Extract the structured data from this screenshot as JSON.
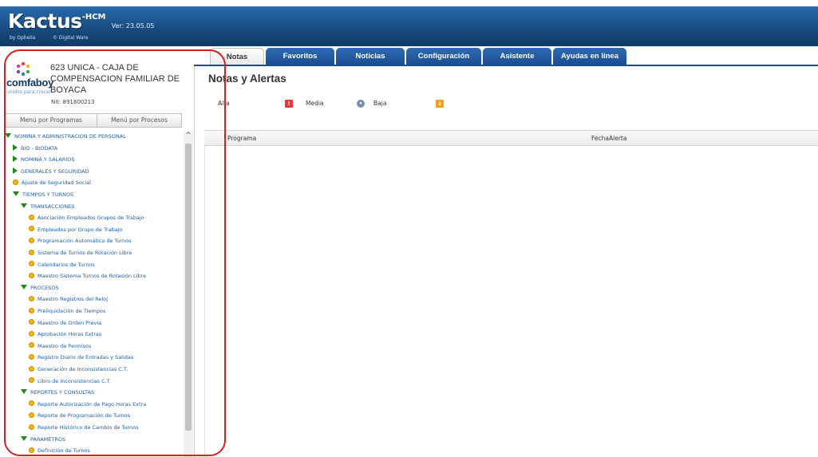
{
  "app": {
    "brand": "Kactus",
    "brand_suffix": "-HCM",
    "version": "Ver: 23.05.05",
    "by_line": "by Ophelia",
    "by_line2": "© Digital Ware"
  },
  "org": {
    "logo_word": "comfaboy",
    "logo_tagline": "unidos para crecer",
    "name": "623 UNICA - CAJA DE COMPENSACION FAMILIAR DE BOYACA",
    "nit": "Nit: 891800213"
  },
  "menu_buttons": {
    "programs": "Menú por Programas",
    "processes": "Menú por Procesos"
  },
  "tree": [
    {
      "label": "NOMINA Y ADMINISTRACION DE PERSONAL",
      "type": "open"
    },
    {
      "label": "BIO - BIODATA",
      "type": "closed"
    },
    {
      "label": "NOMINA Y SALARIOS",
      "type": "closed"
    },
    {
      "label": "GENERALES Y SEGURIDAD",
      "type": "closed"
    },
    {
      "label": "Ajuste de Seguridad Social",
      "type": "leaf"
    },
    {
      "label": "TIEMPOS Y TURNOS",
      "type": "open"
    },
    {
      "label": "TRANSACCIONES",
      "type": "open"
    },
    {
      "label": "Asociación Empleados Grupos de Trabajo",
      "type": "leaf"
    },
    {
      "label": "Empleados por Grupo de Trabajo",
      "type": "leaf"
    },
    {
      "label": "Programación Automática de Turnos",
      "type": "leaf"
    },
    {
      "label": "Sistema de Turnos de Rotación Libre",
      "type": "leaf"
    },
    {
      "label": "Calendarios de Turnos",
      "type": "leaf"
    },
    {
      "label": "Maestro Sistema Turnos de Rotación Libre",
      "type": "leaf"
    },
    {
      "label": "PROCESOS",
      "type": "open"
    },
    {
      "label": "Maestro Registros del Reloj",
      "type": "leaf"
    },
    {
      "label": "Preliquidación de Tiempos",
      "type": "leaf"
    },
    {
      "label": "Maestro de Orden Previa",
      "type": "leaf"
    },
    {
      "label": "Aprobación Horas Extras",
      "type": "leaf"
    },
    {
      "label": "Maestro de Permisos",
      "type": "leaf"
    },
    {
      "label": "Registro Diario de Entradas y Salidas",
      "type": "leaf"
    },
    {
      "label": "Generación de Inconsistencias C.T.",
      "type": "leaf"
    },
    {
      "label": "Libro de Inconsistencias C.T.",
      "type": "leaf"
    },
    {
      "label": "REPORTES Y CONSULTAS",
      "type": "open"
    },
    {
      "label": "Reporte Autorización de Pago Horas Extra",
      "type": "leaf"
    },
    {
      "label": "Reporte de Programación de Turnos",
      "type": "leaf"
    },
    {
      "label": "Reporte Histórico de Cambio de Turnos",
      "type": "leaf"
    },
    {
      "label": "PARAMETROS",
      "type": "open"
    },
    {
      "label": "Definición de Turnos",
      "type": "leaf"
    }
  ],
  "tabs": [
    {
      "label": "Notas",
      "active": true
    },
    {
      "label": "Favoritos",
      "active": false
    },
    {
      "label": "Noticias",
      "active": false
    },
    {
      "label": "Configuración",
      "active": false
    },
    {
      "label": "Asistente",
      "active": false
    },
    {
      "label": "Ayudas en línea",
      "active": false
    }
  ],
  "main": {
    "title": "Notas y Alertas",
    "priority_high": "Alta",
    "priority_medium": "Media",
    "priority_low": "Baja",
    "columns": [
      "Programa",
      "FechaAlerta"
    ]
  },
  "colors": {
    "header": "#16497d",
    "tab": "#1a4c90",
    "tree_text": "#1f5ea8",
    "tree_open": "#1f8a1f",
    "leaf_dot": "#f5b512",
    "highlight": "#d42020",
    "priority_high": "#e53935",
    "priority_medium": "#7d8fa8",
    "priority_low": "#f0a020"
  }
}
